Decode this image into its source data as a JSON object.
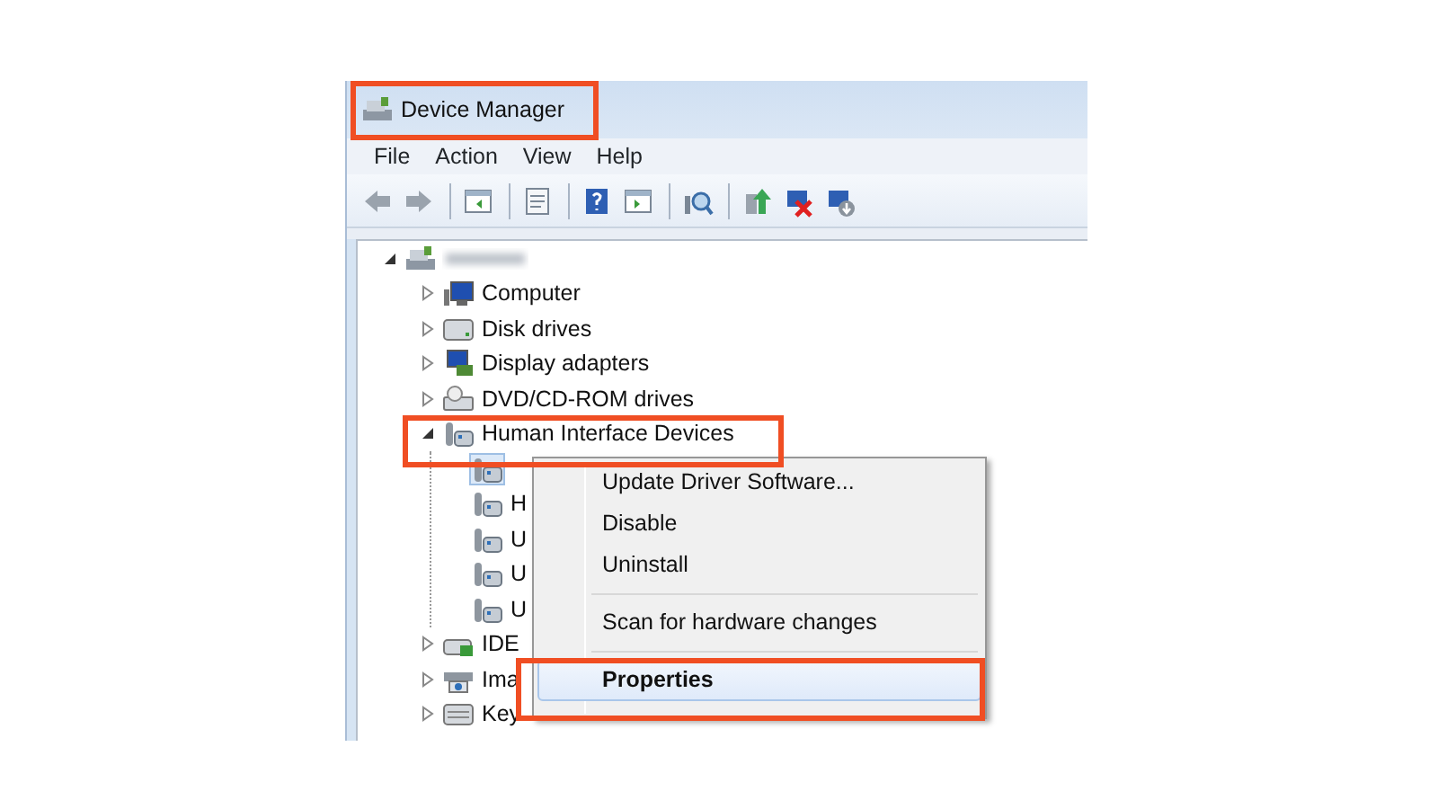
{
  "window": {
    "title": "Device Manager"
  },
  "menu_bar": [
    "File",
    "Action",
    "View",
    "Help"
  ],
  "tree": {
    "root": {
      "kind": "root",
      "expanded": true,
      "children": [
        {
          "label": "Computer",
          "kind": "computer",
          "expanded": false
        },
        {
          "label": "Disk drives",
          "kind": "disk",
          "expanded": false
        },
        {
          "label": "Display adapters",
          "kind": "display",
          "expanded": false
        },
        {
          "label": "DVD/CD-ROM drives",
          "kind": "dvd",
          "expanded": false
        },
        {
          "label": "Human Interface Devices",
          "kind": "hid",
          "expanded": true,
          "children": [
            {
              "kind": "hid",
              "selected": true
            },
            {
              "label": "H",
              "kind": "hid",
              "selected": false
            },
            {
              "label": "U",
              "kind": "hid",
              "selected": false
            },
            {
              "label": "U",
              "kind": "hid",
              "selected": false
            },
            {
              "label": "U",
              "kind": "hid",
              "selected": false
            }
          ]
        },
        {
          "label": "IDE",
          "kind": "ide",
          "expanded": false
        },
        {
          "label": "Ima",
          "kind": "imaging",
          "expanded": false
        },
        {
          "label": "Key",
          "kind": "keyboard",
          "expanded": false
        }
      ]
    }
  },
  "context_menu": [
    {
      "kind": "item",
      "label": "Update Driver Software...",
      "selected": false
    },
    {
      "kind": "item",
      "label": "Disable",
      "selected": false
    },
    {
      "kind": "item",
      "label": "Uninstall",
      "selected": false
    },
    {
      "kind": "separator"
    },
    {
      "kind": "item",
      "label": "Scan for hardware changes",
      "selected": false
    },
    {
      "kind": "separator"
    },
    {
      "kind": "item",
      "label": "Properties",
      "selected": true,
      "default": true
    }
  ]
}
